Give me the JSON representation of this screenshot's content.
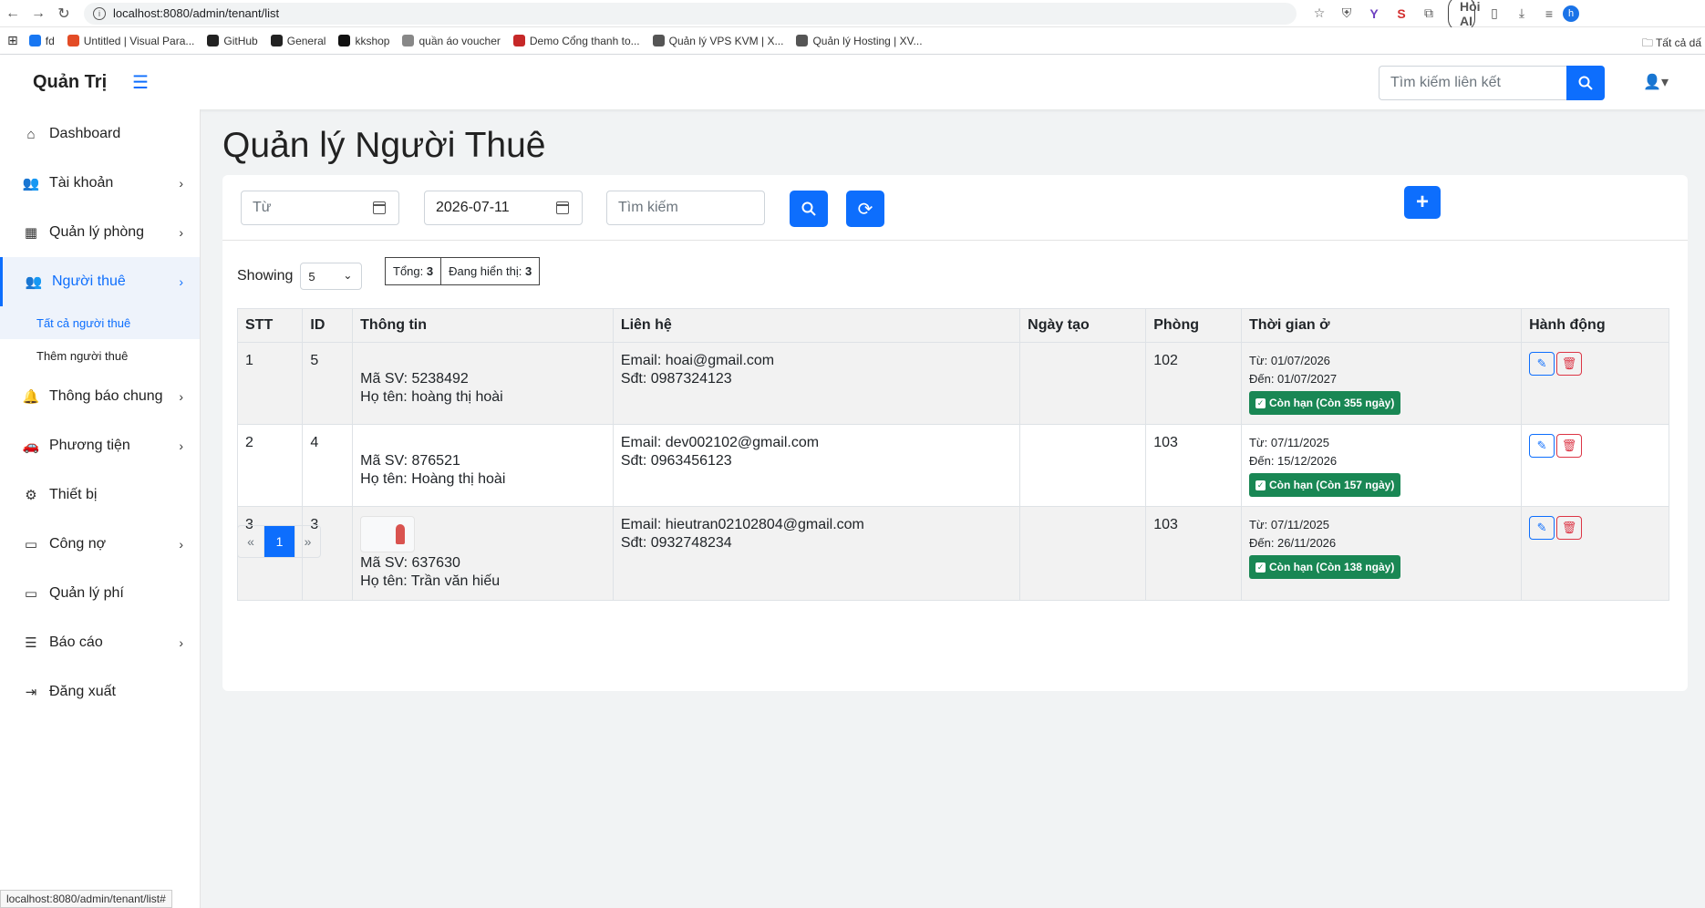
{
  "browser": {
    "url": "localhost:8080/admin/tenant/list",
    "ask_ai": "Hỏi AI",
    "bookmarks": [
      {
        "label": "fd",
        "color": "#1877f2"
      },
      {
        "label": "Untitled | Visual Para...",
        "color": "#e34c26"
      },
      {
        "label": "GitHub",
        "color": "#222222"
      },
      {
        "label": "General",
        "color": "#222222"
      },
      {
        "label": "kkshop",
        "color": "#111111"
      },
      {
        "label": "quần áo voucher",
        "color": "#888888"
      },
      {
        "label": "Demo Cổng thanh to...",
        "color": "#c62828"
      },
      {
        "label": "Quản lý VPS KVM | X...",
        "color": "#555555"
      },
      {
        "label": "Quản lý Hosting | XV...",
        "color": "#555555"
      }
    ],
    "all_bookmarks": "Tất cả dấ",
    "status_url": "localhost:8080/admin/tenant/list#"
  },
  "header": {
    "brand": "Quản Trị",
    "search_placeholder": "Tìm kiếm liên kết"
  },
  "sidebar": {
    "items": [
      {
        "label": "Dashboard",
        "icon": "home-icon",
        "chevron": false
      },
      {
        "label": "Tài khoản",
        "icon": "users-icon",
        "chevron": true
      },
      {
        "label": "Quản lý phòng",
        "icon": "building-icon",
        "chevron": true
      },
      {
        "label": "Người thuê",
        "icon": "user-group-icon",
        "chevron": true,
        "active": true
      },
      {
        "label": "Thông báo chung",
        "icon": "bell-icon",
        "chevron": true
      },
      {
        "label": "Phương tiện",
        "icon": "car-icon",
        "chevron": true
      },
      {
        "label": "Thiết bị",
        "icon": "gears-icon",
        "chevron": false
      },
      {
        "label": "Công nợ",
        "icon": "money-icon",
        "chevron": true
      },
      {
        "label": "Quản lý phí",
        "icon": "money-bill-icon",
        "chevron": false
      },
      {
        "label": "Báo cáo",
        "icon": "report-icon",
        "chevron": true
      },
      {
        "label": "Đăng xuất",
        "icon": "logout-icon",
        "chevron": false
      }
    ],
    "sub_items": [
      {
        "label": "Tất cả người thuê",
        "active": true
      },
      {
        "label": "Thêm người thuê",
        "active": false
      }
    ]
  },
  "page": {
    "title": "Quản lý Người Thuê",
    "filters": {
      "from_placeholder": "Từ",
      "to_value": "2026-07-11",
      "search_placeholder": "Tìm kiếm"
    },
    "showing_label": "Showing",
    "page_size": "5",
    "total_label": "Tổng:",
    "total_value": "3",
    "displaying_label": "Đang hiển thị:",
    "displaying_value": "3",
    "columns": [
      "STT",
      "ID",
      "Thông tin",
      "Liên hệ",
      "Ngày tạo",
      "Phòng",
      "Thời gian ở",
      "Hành động"
    ],
    "rows": [
      {
        "stt": "1",
        "id": "5",
        "ma_sv": "Mã SV: 5238492",
        "ho_ten": "Họ tên: hoàng thị hoài",
        "email": "Email: hoai@gmail.com",
        "sdt": "Sđt: 0987324123",
        "ngay_tao": "",
        "phong": "102",
        "tu": "Từ: 01/07/2026",
        "den": "Đến: 01/07/2027",
        "badge": "Còn hạn (Còn 355 ngày)",
        "has_image": false
      },
      {
        "stt": "2",
        "id": "4",
        "ma_sv": "Mã SV: 876521",
        "ho_ten": "Họ tên: Hoàng thị hoài",
        "email": "Email: dev002102@gmail.com",
        "sdt": "Sđt: 0963456123",
        "ngay_tao": "",
        "phong": "103",
        "tu": "Từ: 07/11/2025",
        "den": "Đến: 15/12/2026",
        "badge": "Còn hạn (Còn 157 ngày)",
        "has_image": false
      },
      {
        "stt": "3",
        "id": "3",
        "ma_sv": "Mã SV: 637630",
        "ho_ten": "Họ tên: Trần văn hiếu",
        "email": "Email: hieutran02102804@gmail.com",
        "sdt": "Sđt: 0932748234",
        "ngay_tao": "",
        "phong": "103",
        "tu": "Từ: 07/11/2025",
        "den": "Đến: 26/11/2026",
        "badge": "Còn hạn (Còn 138 ngày)",
        "has_image": true
      }
    ],
    "pagination": {
      "prev": "«",
      "current": "1",
      "next": "»"
    }
  }
}
